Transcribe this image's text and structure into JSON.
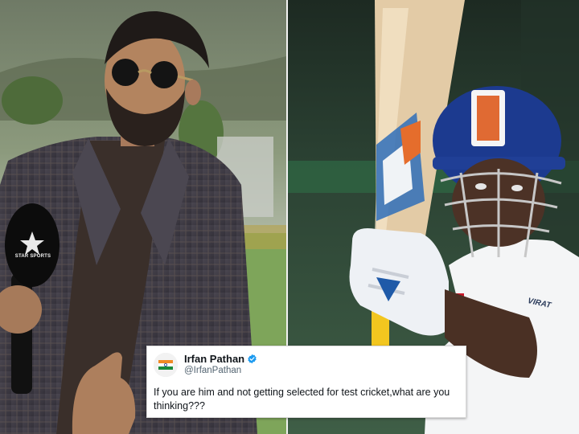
{
  "left_panel": {
    "microphone_logo_text": "STAR SPORTS"
  },
  "right_panel": {
    "shirt_logo_text": "VIRAT"
  },
  "tweet": {
    "author_name": "Irfan Pathan",
    "author_handle": "@IrfanPathan",
    "text": "If you are him and not getting selected for test cricket,what are you thinking???",
    "verified": true
  },
  "colors": {
    "tweet_background": "#ffffff",
    "verified_badge": "#1d9bf0",
    "name_text": "#0f1419",
    "handle_text": "#536471"
  }
}
